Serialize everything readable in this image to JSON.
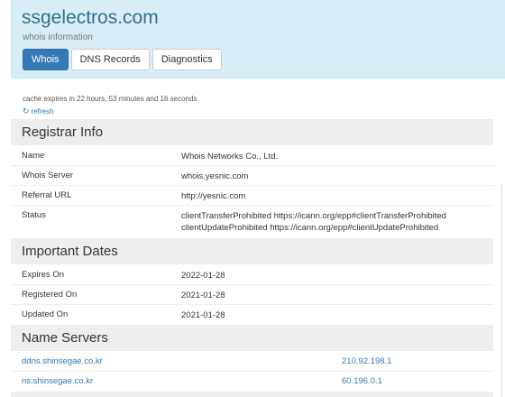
{
  "header": {
    "title": "ssgelectros.com",
    "subtitle": "whois information",
    "tabs": [
      {
        "label": "Whois",
        "active": true
      },
      {
        "label": "DNS Records",
        "active": false
      },
      {
        "label": "Diagnostics",
        "active": false
      }
    ]
  },
  "cache": {
    "text": "cache expires in 22 hours, 53 minutes and 16 seconds",
    "refresh_label": "refresh",
    "refresh_icon": "refresh-icon"
  },
  "registrar": {
    "title": "Registrar Info",
    "rows": [
      {
        "key": "Name",
        "value": "Whois Networks Co., Ltd."
      },
      {
        "key": "Whois Server",
        "value": "whois.yesnic.com"
      },
      {
        "key": "Referral URL",
        "value": "http://yesnic.com"
      },
      {
        "key": "Status",
        "value_lines": [
          "clientTransferProhibited https://icann.org/epp#clientTransferProhibited",
          "clientUpdateProhibited https://icann.org/epp#clientUpdateProhibited"
        ]
      }
    ]
  },
  "dates": {
    "title": "Important Dates",
    "rows": [
      {
        "key": "Expires On",
        "value": "2022-01-28"
      },
      {
        "key": "Registered On",
        "value": "2021-01-28"
      },
      {
        "key": "Updated On",
        "value": "2021-01-28"
      }
    ]
  },
  "nameservers": {
    "title": "Name Servers",
    "rows": [
      {
        "host": "ddns.shinsegae.co.kr",
        "ip": "210.92.198.1"
      },
      {
        "host": "ns.shinsegae.co.kr",
        "ip": "60.196.0.1"
      }
    ]
  },
  "colors": {
    "header_bg": "#d9edf7",
    "title": "#31708f",
    "accent": "#337ab7",
    "section_bg": "#eeeeee"
  }
}
